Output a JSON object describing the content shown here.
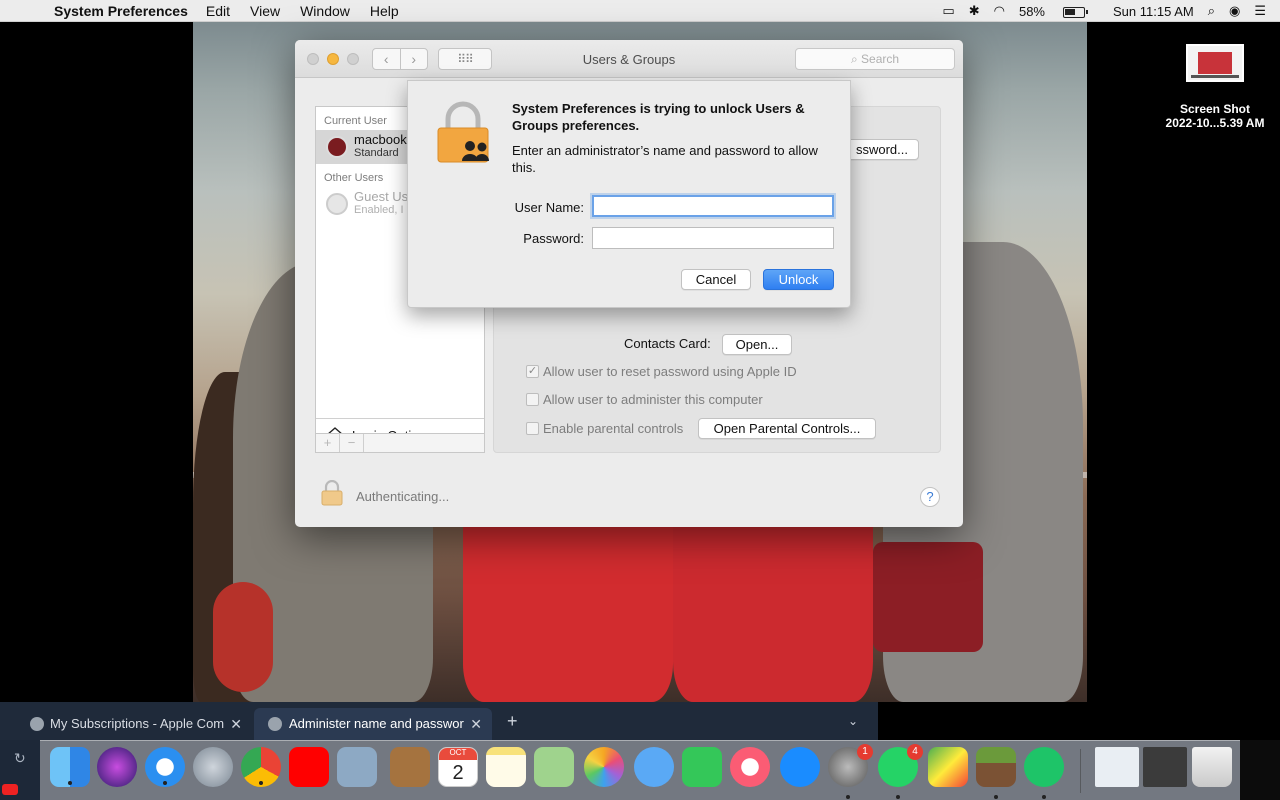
{
  "menubar": {
    "app_name": "System Preferences",
    "menus": [
      "Edit",
      "View",
      "Window",
      "Help"
    ],
    "battery": "58%",
    "clock": "Sun 11:15 AM"
  },
  "desktop_icon": {
    "label_line1": "Screen Shot",
    "label_line2": "2022-10...5.39 AM"
  },
  "window": {
    "title": "Users & Groups",
    "search_placeholder": "Search",
    "sidebar": {
      "current_user_header": "Current User",
      "current_user_name": "macbook",
      "current_user_role": "Standard",
      "other_users_header": "Other Users",
      "guest_name": "Guest Us",
      "guest_status": "Enabled, I",
      "login_options": "Login Options",
      "add_label": "+",
      "remove_label": "−"
    },
    "panel": {
      "password_button": "ssword...",
      "contacts_label": "Contacts Card:",
      "contacts_open": "Open...",
      "allow_reset": "Allow user to reset password using Apple ID",
      "allow_admin": "Allow user to administer this computer",
      "parental": "Enable parental controls",
      "parental_button": "Open Parental Controls...",
      "reset_checked_mark": "✓"
    },
    "footer": {
      "status": "Authenticating...",
      "help": "?"
    }
  },
  "sheet": {
    "title": "System Preferences is trying to unlock Users & Groups preferences.",
    "message": "Enter an administrator’s name and password to allow this.",
    "username_label": "User Name:",
    "username_value": "",
    "password_label": "Password:",
    "password_value": "",
    "cancel": "Cancel",
    "unlock": "Unlock"
  },
  "browser_tabs": {
    "tab1": "My Subscriptions - Apple Com",
    "tab2": "Administer name and passwor",
    "close": "✕",
    "new_tab": "+",
    "chevron": "⌄"
  },
  "dock": {
    "calendar_month": "OCT",
    "calendar_day": "2",
    "system_prefs_badge": "1",
    "whatsapp_badge": "4"
  }
}
